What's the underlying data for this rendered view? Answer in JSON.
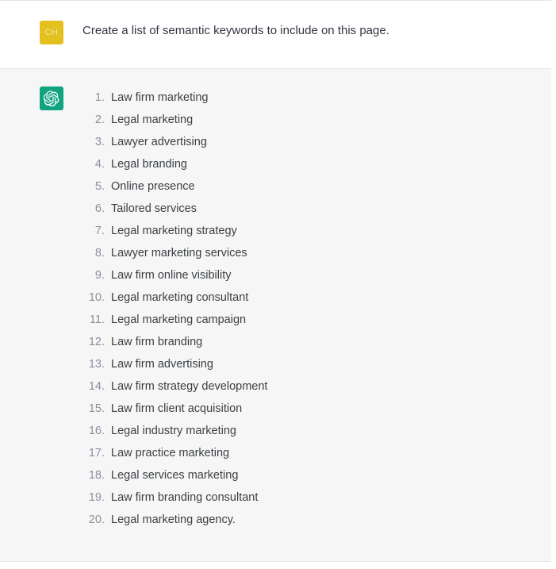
{
  "theme": {
    "page_background": "#ffffff",
    "assistant_background": "#f6f6f7",
    "divider_color": "#e5e5e5",
    "text_color": "#343541",
    "list_text_color": "#3c4043",
    "list_number_color": "#8e8ea0",
    "user_avatar_background": "#e3c01f",
    "user_avatar_text_color": "#f3e4a0",
    "assistant_avatar_background": "#10a37f"
  },
  "messages": [
    {
      "role": "user",
      "avatar": {
        "initials": "CH",
        "icon_name": "user-avatar-initials"
      },
      "text": "Create a list of semantic keywords to include on this page."
    },
    {
      "role": "assistant",
      "avatar": {
        "initials": "",
        "icon_name": "openai-logo-icon"
      },
      "list": [
        {
          "number": "1.",
          "text": "Law firm marketing"
        },
        {
          "number": "2.",
          "text": "Legal marketing"
        },
        {
          "number": "3.",
          "text": "Lawyer advertising"
        },
        {
          "number": "4.",
          "text": "Legal branding"
        },
        {
          "number": "5.",
          "text": "Online presence"
        },
        {
          "number": "6.",
          "text": "Tailored services"
        },
        {
          "number": "7.",
          "text": "Legal marketing strategy"
        },
        {
          "number": "8.",
          "text": "Lawyer marketing services"
        },
        {
          "number": "9.",
          "text": "Law firm online visibility"
        },
        {
          "number": "10.",
          "text": "Legal marketing consultant"
        },
        {
          "number": "11.",
          "text": "Legal marketing campaign"
        },
        {
          "number": "12.",
          "text": "Law firm branding"
        },
        {
          "number": "13.",
          "text": "Law firm advertising"
        },
        {
          "number": "14.",
          "text": "Law firm strategy development"
        },
        {
          "number": "15.",
          "text": "Law firm client acquisition"
        },
        {
          "number": "16.",
          "text": "Legal industry marketing"
        },
        {
          "number": "17.",
          "text": "Law practice marketing"
        },
        {
          "number": "18.",
          "text": "Legal services marketing"
        },
        {
          "number": "19.",
          "text": "Law firm branding consultant"
        },
        {
          "number": "20.",
          "text": "Legal marketing agency."
        }
      ]
    }
  ]
}
